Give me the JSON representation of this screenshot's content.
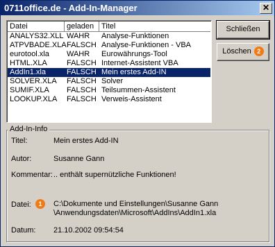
{
  "window": {
    "title": "0711office.de - Add-In-Manager",
    "close_glyph": "✕"
  },
  "list": {
    "columns": [
      "Datei",
      "geladen",
      "Titel"
    ],
    "rows": [
      [
        "ANALYS32.XLL",
        "WAHR",
        "Analyse-Funktionen"
      ],
      [
        "ATPVBADE.XLA",
        "FALSCH",
        "Analyse-Funktionen - VBA"
      ],
      [
        "eurotool.xla",
        "WAHR",
        "Eurowährungs-Tool"
      ],
      [
        "HTML.XLA",
        "FALSCH",
        "Internet-Assistent VBA"
      ],
      [
        "AddIn1.xla",
        "FALSCH",
        "Mein erstes Add-IN"
      ],
      [
        "SOLVER.XLA",
        "FALSCH",
        "Solver"
      ],
      [
        "SUMIF.XLA",
        "FALSCH",
        "Teilsummen-Assistent"
      ],
      [
        "LOOKUP.XLA",
        "FALSCH",
        "Verweis-Assistent"
      ]
    ],
    "selected_index": 4
  },
  "buttons": {
    "close_label": "Schließen",
    "delete_label": "Löschen",
    "delete_badge": "2"
  },
  "info": {
    "group_title": "Add-In-Info",
    "title_label": "Titel:",
    "title_value": "Mein erstes Add-IN",
    "author_label": "Autor:",
    "author_value": "Susanne Gann",
    "comment_label": "Kommentar:",
    "comment_value": ".. enthält supernützliche Funktionen!",
    "file_label": "Datei:",
    "file_badge": "1",
    "file_value_line1": "C:\\Dokumente und Einstellungen\\Susanne Gann",
    "file_value_line2": "\\Anwendungsdaten\\Microsoft\\AddIns\\AddIn1.xla",
    "date_label": "Datum:",
    "date_value": "21.10.2002 09:54:54"
  },
  "colors": {
    "selection": "#0a246a",
    "badge": "#f07a14",
    "titlebar": "#0a246a"
  }
}
